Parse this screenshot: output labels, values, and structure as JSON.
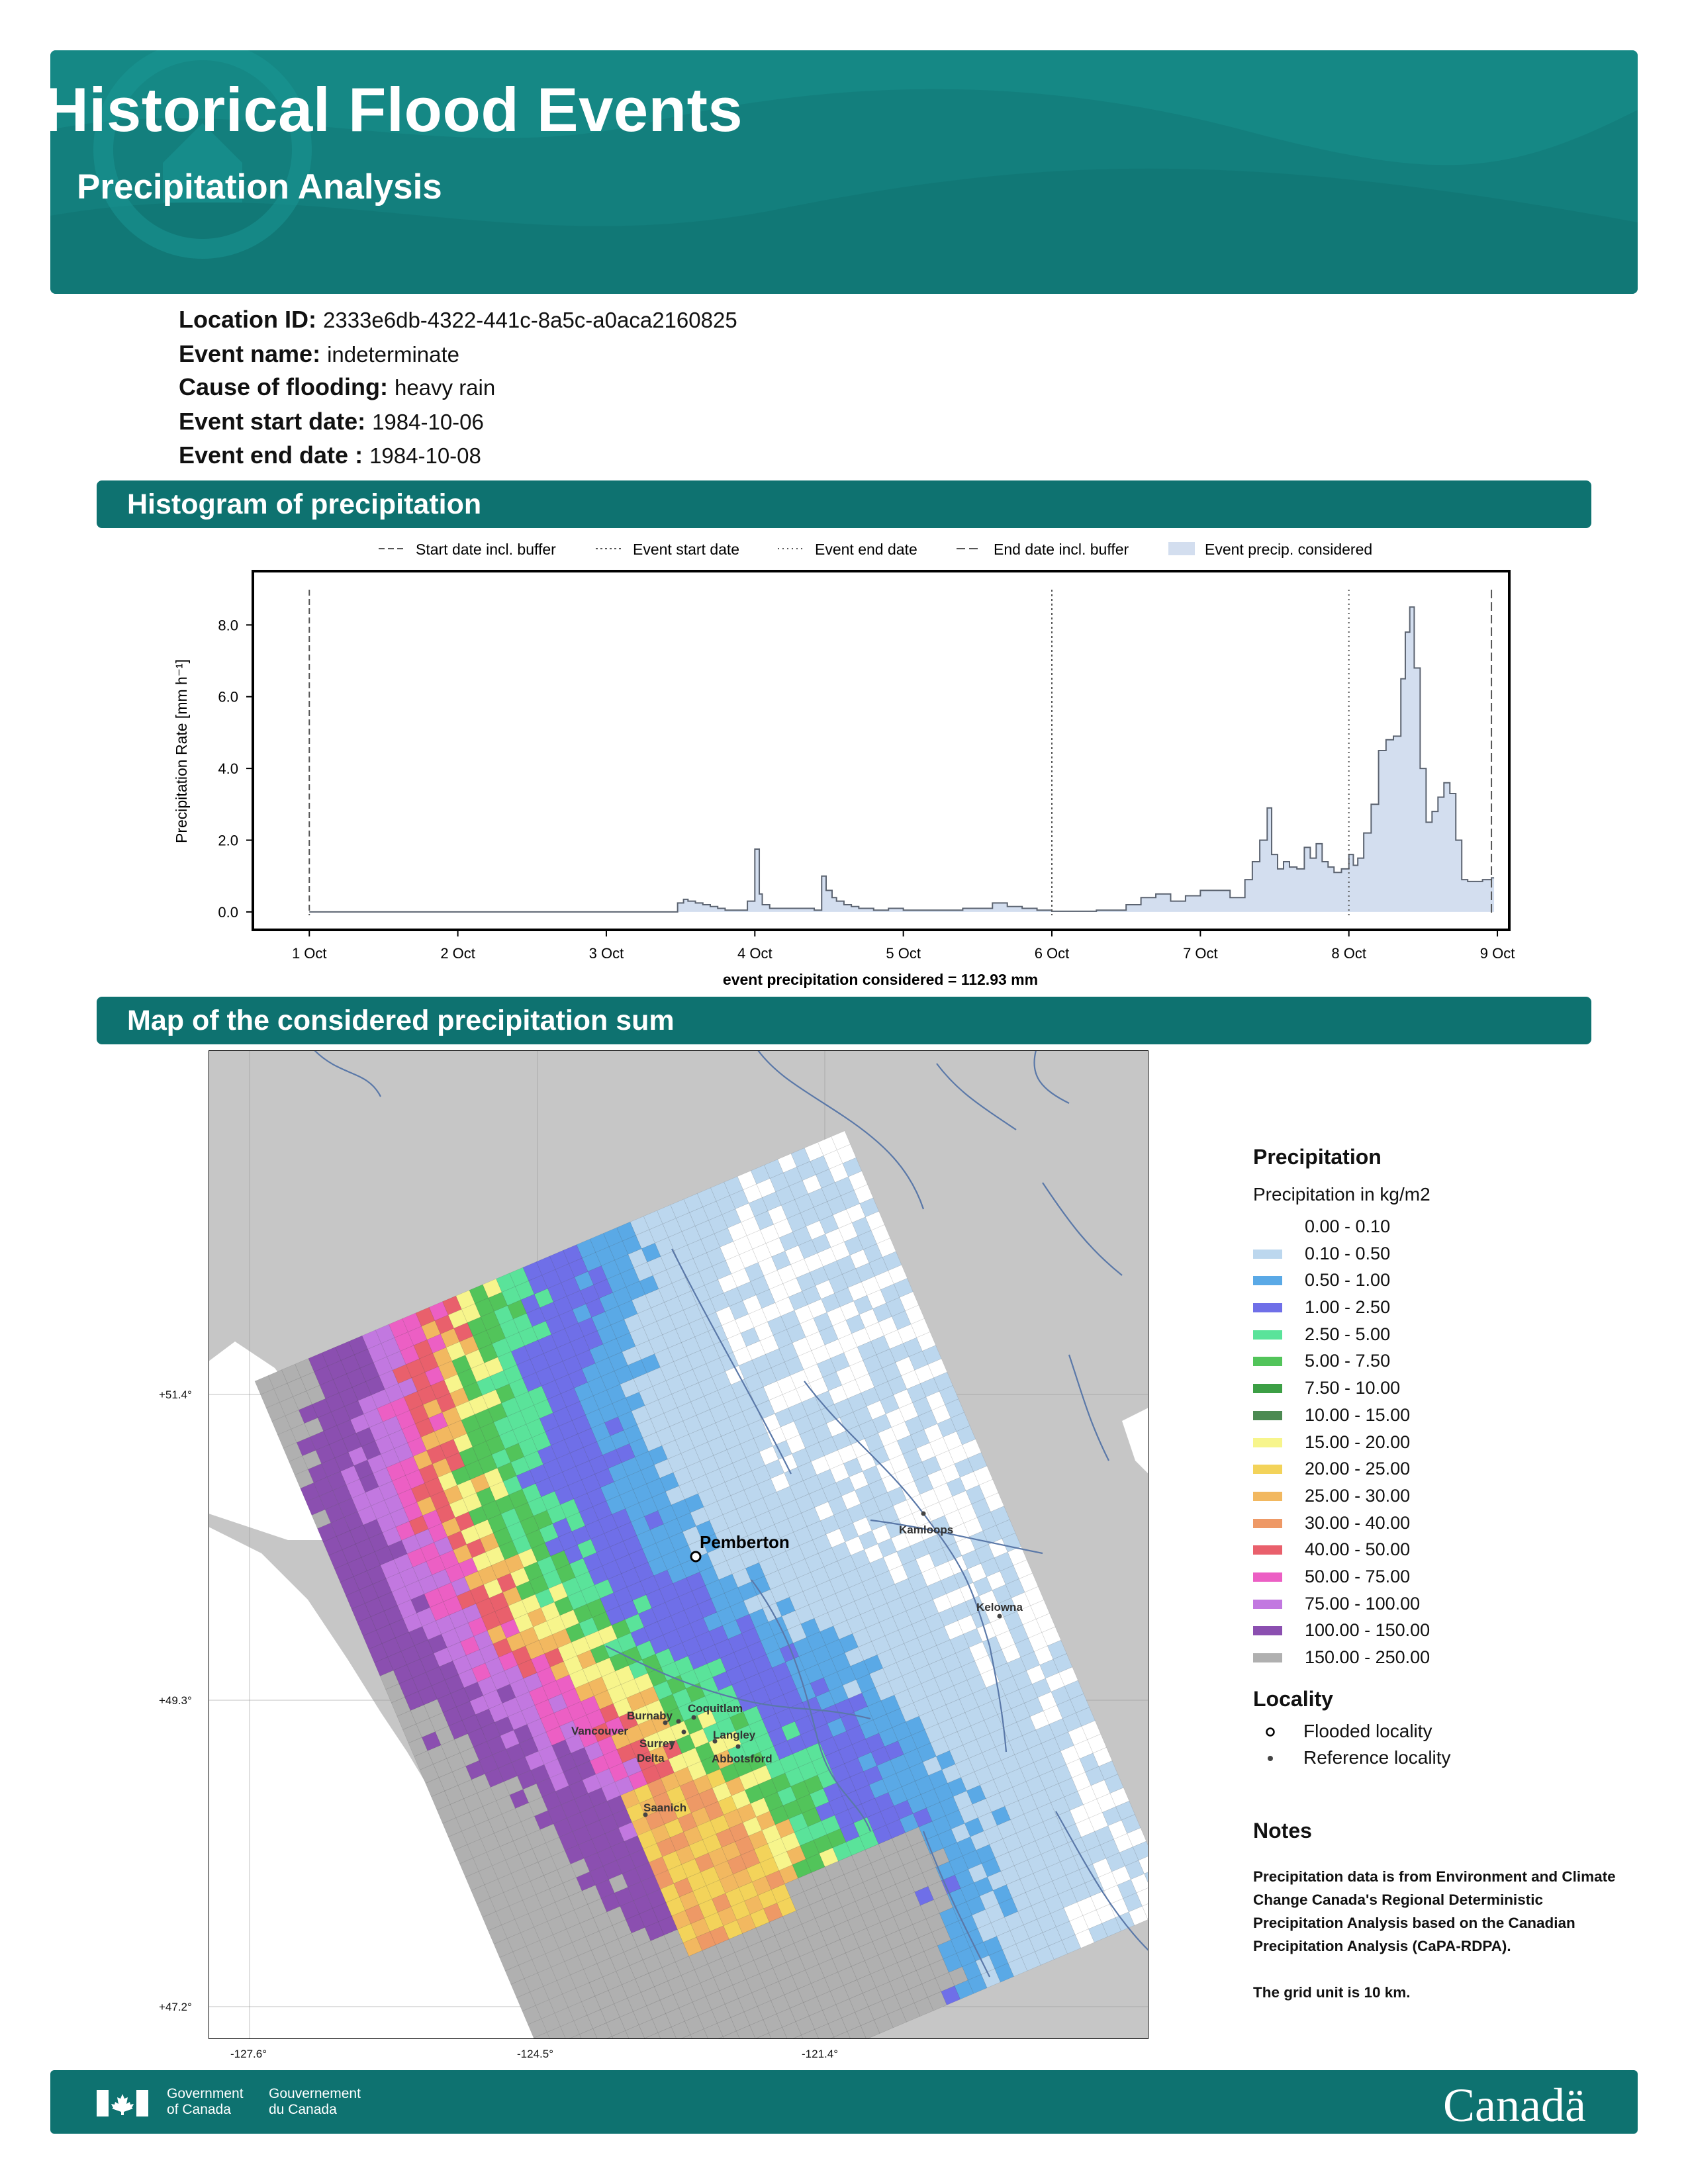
{
  "header": {
    "title": "Historical Flood Events",
    "subtitle": "Precipitation Analysis"
  },
  "event": {
    "fields": [
      {
        "label": "Location ID:",
        "value": "2333e6db-4322-441c-8a5c-a0aca2160825"
      },
      {
        "label": "Event name:",
        "value": "indeterminate"
      },
      {
        "label": "Cause of flooding:",
        "value": "heavy rain"
      },
      {
        "label": "Event start date:",
        "value": "1984-10-06"
      },
      {
        "label": "Event end date :",
        "value": "1984-10-08"
      }
    ]
  },
  "sections": {
    "histogram": "Histogram of precipitation",
    "map": "Map of the considered precipitation sum"
  },
  "chart_data": {
    "type": "area",
    "title": "",
    "xlabel": "event precipitation considered = 112.93 mm",
    "ylabel": "Precipitation Rate [mm h⁻¹]",
    "ylim": [
      -0.5,
      9.5
    ],
    "xlim": [
      0.62,
      9.08
    ],
    "x_ticks": [
      1,
      2,
      3,
      4,
      5,
      6,
      7,
      8,
      9
    ],
    "x_tick_labels": [
      "1 Oct",
      "2 Oct",
      "3 Oct",
      "4 Oct",
      "5 Oct",
      "6 Oct",
      "7 Oct",
      "8 Oct",
      "9 Oct"
    ],
    "y_ticks": [
      0,
      2,
      4,
      6,
      8
    ],
    "y_tick_labels": [
      "0.0",
      "2.0",
      "4.0",
      "6.0",
      "8.0"
    ],
    "grid": false,
    "legend_position": "top",
    "legend": [
      "Start date incl. buffer",
      "Event start date",
      "Event end date",
      "End date incl. buffer",
      "Event precip. considered"
    ],
    "vlines": {
      "start_buffer": 1.0,
      "event_start": 6.0,
      "event_end": 8.0,
      "end_buffer": 8.96
    },
    "series": [
      {
        "name": "Event precip. considered",
        "x": [
          1.0,
          3.48,
          3.52,
          3.55,
          3.6,
          3.65,
          3.7,
          3.75,
          3.8,
          3.85,
          3.95,
          4.0,
          4.03,
          4.05,
          4.1,
          4.4,
          4.45,
          4.48,
          4.52,
          4.55,
          4.6,
          4.65,
          4.7,
          4.8,
          4.9,
          5.0,
          5.2,
          5.4,
          5.6,
          5.7,
          5.8,
          5.9,
          6.0,
          6.3,
          6.5,
          6.6,
          6.7,
          6.8,
          6.9,
          7.0,
          7.2,
          7.3,
          7.35,
          7.4,
          7.45,
          7.48,
          7.52,
          7.56,
          7.6,
          7.65,
          7.7,
          7.74,
          7.78,
          7.82,
          7.86,
          7.9,
          7.95,
          8.0,
          8.03,
          8.06,
          8.1,
          8.15,
          8.2,
          8.25,
          8.3,
          8.35,
          8.38,
          8.41,
          8.44,
          8.48,
          8.52,
          8.56,
          8.6,
          8.64,
          8.68,
          8.72,
          8.76,
          8.8,
          8.9,
          8.96
        ],
        "values": [
          0.0,
          0.25,
          0.35,
          0.3,
          0.25,
          0.2,
          0.15,
          0.1,
          0.05,
          0.05,
          0.3,
          1.75,
          0.5,
          0.2,
          0.1,
          0.05,
          1.0,
          0.6,
          0.4,
          0.3,
          0.2,
          0.15,
          0.1,
          0.05,
          0.1,
          0.05,
          0.05,
          0.1,
          0.25,
          0.15,
          0.1,
          0.05,
          0.02,
          0.05,
          0.2,
          0.4,
          0.5,
          0.3,
          0.45,
          0.6,
          0.4,
          0.9,
          1.4,
          2.0,
          2.9,
          1.6,
          1.2,
          1.4,
          1.25,
          1.2,
          1.8,
          1.5,
          1.9,
          1.4,
          1.25,
          1.1,
          1.2,
          1.6,
          1.3,
          1.5,
          2.2,
          3.0,
          4.5,
          4.8,
          4.9,
          6.5,
          7.8,
          8.5,
          6.8,
          4.0,
          2.5,
          2.8,
          3.2,
          3.6,
          3.3,
          2.0,
          0.9,
          0.85,
          0.9,
          0.95
        ]
      }
    ]
  },
  "map": {
    "lat_labels": [
      "+51.4°",
      "+49.3°",
      "+47.2°"
    ],
    "lon_labels": [
      "-127.6°",
      "-124.5°",
      "-121.4°"
    ],
    "flooded_locality": "Pemberton",
    "reference_localities": [
      "Kamloops",
      "Kelowna",
      "Coquitlam",
      "Burnaby",
      "Vancouver",
      "Surrey",
      "Delta",
      "Langley",
      "Abbotsford",
      "Saanich"
    ]
  },
  "legend": {
    "title": "Precipitation",
    "subtitle": "Precipitation in kg/m2",
    "classes": [
      {
        "label": "0.00 - 0.10",
        "color": "#ffffff"
      },
      {
        "label": "0.10 - 0.50",
        "color": "#bcd7ee"
      },
      {
        "label": "0.50 - 1.00",
        "color": "#5aa9e6"
      },
      {
        "label": "1.00 - 2.50",
        "color": "#6f6fe8"
      },
      {
        "label": "2.50 - 5.00",
        "color": "#5ae39a"
      },
      {
        "label": "5.00 - 7.50",
        "color": "#52c45a"
      },
      {
        "label": "7.50 - 10.00",
        "color": "#3c9f45"
      },
      {
        "label": "10.00 - 15.00",
        "color": "#4c8a52"
      },
      {
        "label": "15.00 - 20.00",
        "color": "#f7f58c"
      },
      {
        "label": "20.00 - 25.00",
        "color": "#f3d35a"
      },
      {
        "label": "25.00 - 30.00",
        "color": "#f2b860"
      },
      {
        "label": "30.00 - 40.00",
        "color": "#ee9966"
      },
      {
        "label": "40.00 - 50.00",
        "color": "#e9606c"
      },
      {
        "label": "50.00 - 75.00",
        "color": "#ec5fc4"
      },
      {
        "label": "75.00 - 100.00",
        "color": "#c278e0"
      },
      {
        "label": "100.00 - 150.00",
        "color": "#8b4fb0"
      },
      {
        "label": "150.00 - 250.00",
        "color": "#b0b0b0"
      }
    ],
    "locality_title": "Locality",
    "flooded_label": "Flooded locality",
    "reference_label": "Reference locality"
  },
  "notes": {
    "title": "Notes",
    "text1": "Precipitation data is from Environment and Climate Change Canada's Regional Deterministic Precipitation Analysis based on the Canadian Precipitation Analysis (CaPA-RDPA).",
    "text2": "The grid unit is 10 km."
  },
  "footer": {
    "gov_en": "Government\nof Canada",
    "gov_fr": "Gouvernement\ndu Canada",
    "wordmark": "Canadä"
  }
}
